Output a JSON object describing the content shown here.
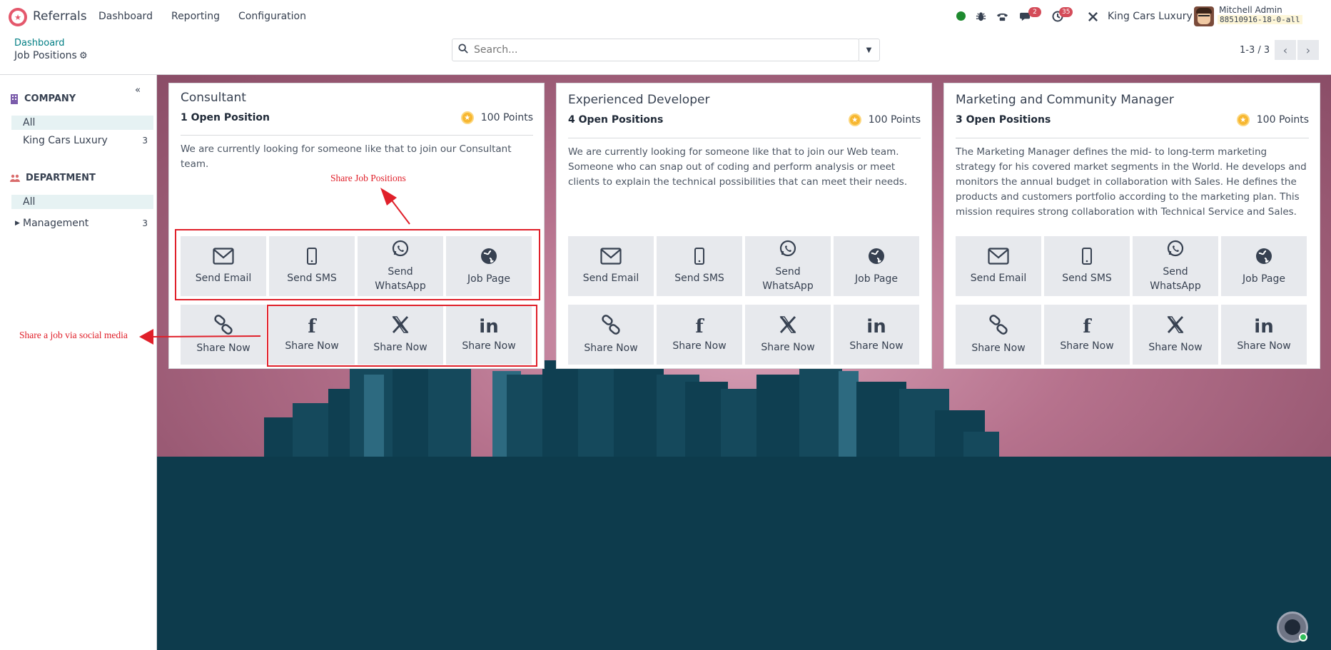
{
  "app": {
    "name": "Referrals"
  },
  "nav": {
    "items": [
      "Dashboard",
      "Reporting",
      "Configuration"
    ]
  },
  "systray": {
    "messages_count": "2",
    "activities_count": "35",
    "company": "King Cars Luxury",
    "user_name": "Mitchell Admin",
    "db_name": "88510916-18-0-all"
  },
  "breadcrumb": {
    "parent": "Dashboard",
    "current": "Job Positions"
  },
  "search": {
    "placeholder": "Search..."
  },
  "pager": {
    "value": "1-3 / 3"
  },
  "sidebar": {
    "company": {
      "heading": "COMPANY",
      "items": [
        {
          "label": "All",
          "count": ""
        },
        {
          "label": "King Cars Luxury",
          "count": "3"
        }
      ]
    },
    "department": {
      "heading": "DEPARTMENT",
      "items": [
        {
          "label": "All",
          "count": ""
        },
        {
          "label": "Management",
          "count": "3"
        }
      ]
    }
  },
  "jobs": [
    {
      "title": "Consultant",
      "positions": "1 Open Position",
      "points": "100 Points",
      "description": "We are currently looking for someone like that to join our Consultant team."
    },
    {
      "title": "Experienced Developer",
      "positions": "4 Open Positions",
      "points": "100 Points",
      "description": "We are currently looking for someone like that to join our Web team. Someone who can snap out of coding and perform analysis or meet clients to explain the technical possibilities that can meet their needs."
    },
    {
      "title": "Marketing and Community Manager",
      "positions": "3 Open Positions",
      "points": "100 Points",
      "description": "The Marketing Manager defines the mid- to long-term marketing strategy for his covered market segments in the World. He develops and monitors the annual budget in collaboration with Sales. He defines the products and customers portfolio according to the marketing plan. This mission requires strong collaboration with Technical Service and Sales."
    }
  ],
  "share_actions": {
    "send_email": "Send Email",
    "send_sms": "Send SMS",
    "send_whatsapp": "Send WhatsApp",
    "job_page": "Job Page",
    "share_now": "Share Now"
  },
  "annotations": {
    "share_job_positions": "Share Job Positions",
    "share_social": "Share a job via social media"
  },
  "colors": {
    "brand": "#e4586c",
    "link": "#017e84",
    "annotation": "#e0202a",
    "ground": "#0d3b4c"
  }
}
